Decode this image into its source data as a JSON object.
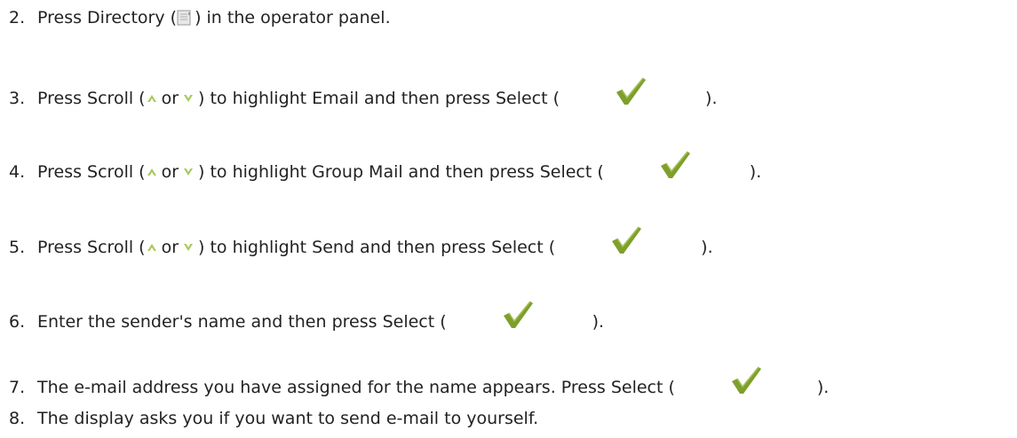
{
  "steps": [
    {
      "num": "2.",
      "text_before": "Press Directory (",
      "icon": "directory-icon",
      "text_after": ") in the operator panel."
    },
    {
      "num": "3.",
      "text_before": "Press Scroll (",
      "or_text": "or",
      "text_mid": ") to highlight Email and then press Select (",
      "text_end": ")."
    },
    {
      "num": "4.",
      "text_before": "Press Scroll (",
      "or_text": "or",
      "text_mid": ") to highlight Group Mail and then press Select (",
      "text_end": ")."
    },
    {
      "num": "5.",
      "text_before": "Press Scroll (",
      "or_text": "or",
      "text_mid": ") to highlight Send and then press Select (",
      "text_end": ")."
    },
    {
      "num": "6.",
      "text_before": "Enter the sender's name and then press Select (",
      "text_end": ")."
    },
    {
      "num": "7.",
      "text_before": "The e-mail address you have assigned for the name appears. Press Select (",
      "text_end": ")."
    },
    {
      "num": "8.",
      "text_before": "The display asks you if you want to send e-mail to yourself."
    }
  ],
  "icons": {
    "directory": "directory-icon",
    "scroll_up": "scroll-up-icon",
    "scroll_down": "scroll-down-icon",
    "select": "select-checkmark-icon"
  },
  "colors": {
    "text": "#222222",
    "checkmark": "#6a8a1f",
    "scroll_arrow": "#8fb13a"
  }
}
